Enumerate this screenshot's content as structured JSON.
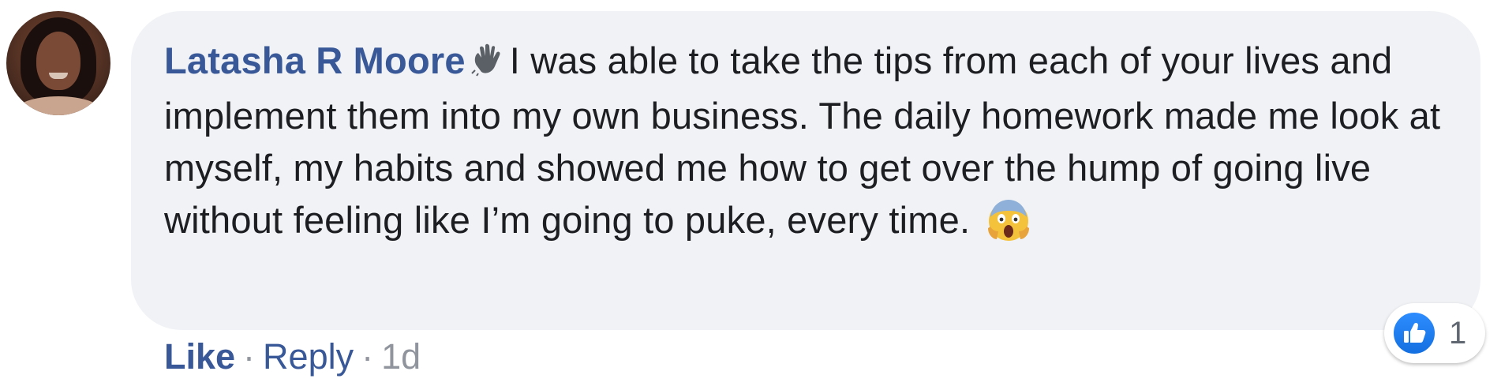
{
  "comment": {
    "author": "Latasha R Moore",
    "author_icon": "waving-hand-icon",
    "body": "I was able to take the tips from each of your lives and implement them into my own business. The daily homework made me look at myself, my habits and showed me how to get over the hump of going live without feeling like I’m going to puke, every time.",
    "end_emoji": "screaming-face-icon",
    "reaction_count": "1",
    "reaction_icon": "like-thumb-icon",
    "colors": {
      "author": "#385898",
      "body": "#1c1e21",
      "bubble": "#f0f2f5",
      "action": "#385898",
      "meta": "#90949c",
      "like_badge": "#1877f2"
    }
  },
  "actions": {
    "like_label": "Like",
    "separator": "·",
    "reply_label": "Reply",
    "timestamp": "1d"
  }
}
